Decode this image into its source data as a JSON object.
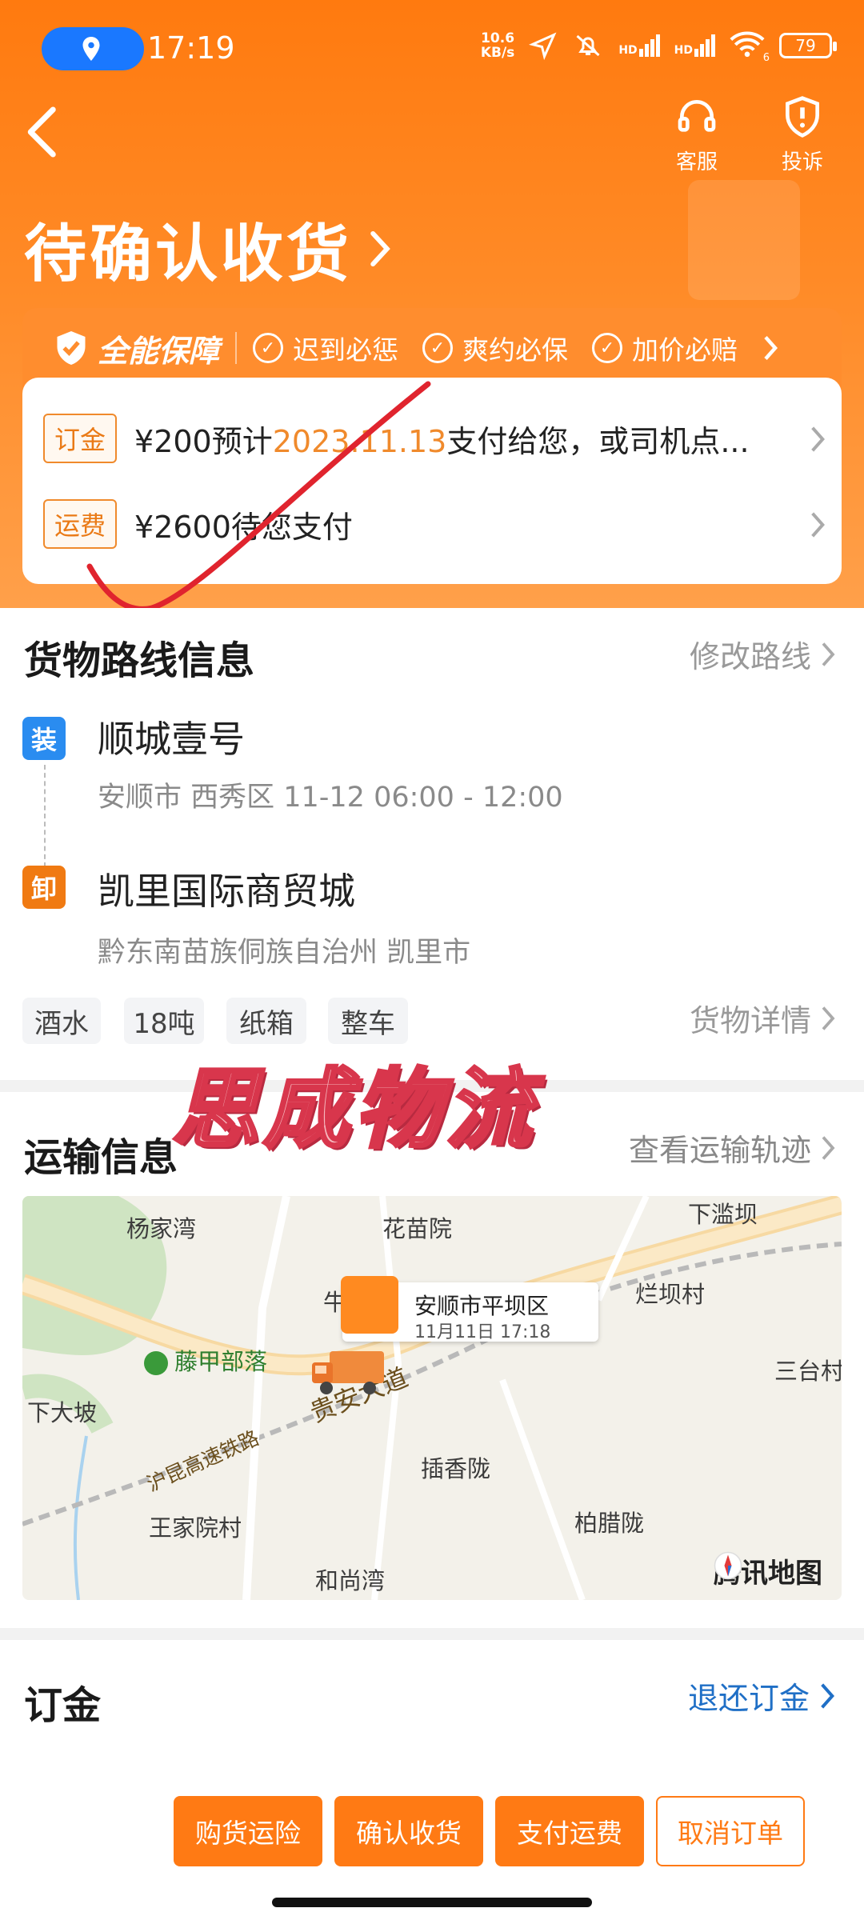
{
  "status_bar": {
    "time": "17:19",
    "net_speed_value": "10.6",
    "net_speed_unit": "KB/s",
    "signal1": "HD",
    "signal2": "HD",
    "wifi_sub": "6",
    "battery": "79"
  },
  "nav": {
    "service_label": "客服",
    "complaint_label": "投诉",
    "page_title": "待确认收货"
  },
  "guarantee": {
    "title": "全能保障",
    "items": [
      "迟到必惩",
      "爽约必保",
      "加价必赔"
    ]
  },
  "payments": [
    {
      "tag": "订金",
      "prefix": "¥200预计",
      "date": "2023.11.13",
      "suffix": "支付给您，或司机点..."
    },
    {
      "tag": "运费",
      "text": "¥2600待您支付"
    }
  ],
  "route": {
    "title": "货物路线信息",
    "edit_label": "修改路线",
    "load": {
      "badge": "装",
      "name": "顺城壹号",
      "sub": "安顺市 西秀区   11-12 06:00 - 12:00"
    },
    "unload": {
      "badge": "卸",
      "name": "凯里国际商贸城",
      "sub": "黔东南苗族侗族自治州 凯里市"
    },
    "chips": [
      "酒水",
      "18吨",
      "纸箱",
      "整车"
    ],
    "details_label": "货物详情"
  },
  "watermark": "思成物流",
  "transport": {
    "title": "运输信息",
    "track_label": "查看运输轨迹",
    "map": {
      "places": [
        "杨家湾",
        "花苗院",
        "下滥坝",
        "烂坝村",
        "牛",
        "藤甲部落",
        "下大坡",
        "三台村",
        "插香陇",
        "柏腊陇",
        "王家院村",
        "和尚湾"
      ],
      "roads": [
        "贵安大道",
        "沪昆高速铁路"
      ],
      "bubble_title": "安顺市平坝区",
      "bubble_time": "11月11日 17:18",
      "brand": "腾讯地图"
    }
  },
  "deposit": {
    "title": "订金",
    "refund_label": "退还订金"
  },
  "actions": [
    "购货运险",
    "确认收货",
    "支付运费",
    "取消订单"
  ],
  "colors": {
    "brand_orange": "#ff7a14",
    "accent_text": "#f08a2c",
    "link_blue": "#1f6fc6"
  }
}
